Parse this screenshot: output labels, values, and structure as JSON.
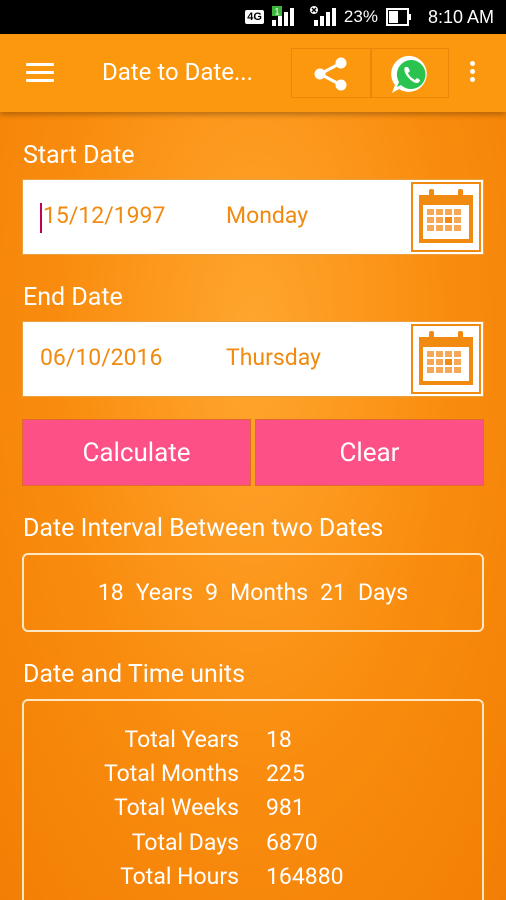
{
  "status_bar": {
    "network": "4G",
    "sim_badge": "1",
    "battery": "23%",
    "time": "8:10 AM"
  },
  "app_bar": {
    "title": "Date to Date...",
    "menu_icon": "hamburger-menu-icon",
    "share_icon": "share-icon",
    "whatsapp_icon": "whatsapp-icon",
    "overflow_icon": "overflow-menu-icon"
  },
  "start_date": {
    "label": "Start Date",
    "value": "15/12/1997",
    "weekday": "Monday"
  },
  "end_date": {
    "label": "End Date",
    "value": "06/10/2016",
    "weekday": "Thursday"
  },
  "buttons": {
    "calculate": "Calculate",
    "clear": "Clear"
  },
  "interval": {
    "label": "Date Interval Between two Dates",
    "years": "18",
    "years_label": "Years",
    "months": "9",
    "months_label": "Months",
    "days": "21",
    "days_label": "Days"
  },
  "units": {
    "label": "Date and Time units",
    "rows": [
      {
        "name": "Total Years",
        "value": "18"
      },
      {
        "name": "Total Months",
        "value": "225"
      },
      {
        "name": "Total Weeks",
        "value": "981"
      },
      {
        "name": "Total Days",
        "value": "6870"
      },
      {
        "name": "Total Hours",
        "value": "164880"
      }
    ]
  },
  "colors": {
    "background": "#f98c0e",
    "app_bar": "#fb980d",
    "button": "#fd5087",
    "field_text": "#f08a10"
  }
}
